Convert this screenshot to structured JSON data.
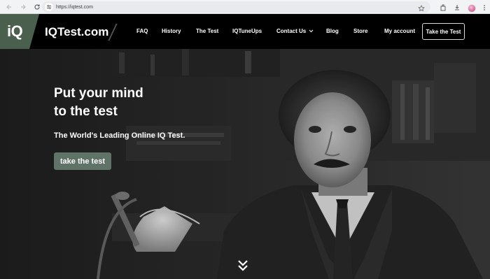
{
  "browser": {
    "url": "https://iqtest.com"
  },
  "header": {
    "logo": "iQ",
    "brand": "IQTest.com",
    "menu": [
      {
        "label": "FAQ"
      },
      {
        "label": "History"
      },
      {
        "label": "The Test"
      },
      {
        "label": "IQTuneUps"
      },
      {
        "label": "Contact Us"
      },
      {
        "label": "Blog"
      },
      {
        "label": "Store"
      },
      {
        "label": "My account"
      }
    ],
    "cta_label": "Take the Test"
  },
  "hero": {
    "headline_line1": "Put your mind",
    "headline_line2": "to the test",
    "subheadline": "The World's Leading Online IQ Test.",
    "cta_label": "take the test"
  },
  "colors": {
    "accent": "#5f7466",
    "logo_bg": "#4b5f4f",
    "header_bg": "#000000"
  }
}
